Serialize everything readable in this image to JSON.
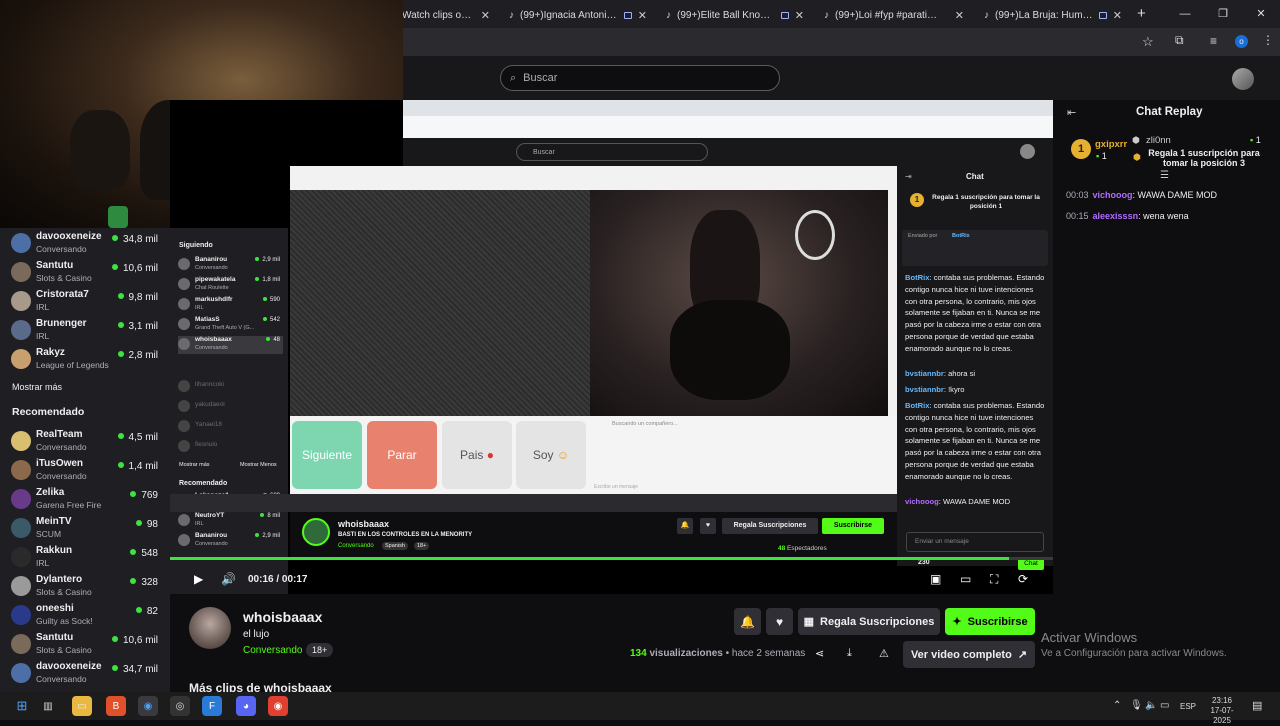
{
  "tabs": [
    {
      "title": "Watch clips on K",
      "icon": ""
    },
    {
      "title": "(99+)Ignacia Antonia y AKA",
      "icon": "tiktok"
    },
    {
      "title": "(99+)Elite Ball Knowlage. #",
      "icon": "tiktok"
    },
    {
      "title": "(99+)Loi #fyp #paratiiiiiiiiiiiii",
      "icon": "tiktok"
    },
    {
      "title": "(99+)La Bruja: Humor Peru",
      "icon": "tiktok"
    }
  ],
  "search": {
    "placeholder": "Buscar"
  },
  "sidebar": {
    "top_channels": [
      {
        "name": "davooxeneize",
        "category": "Conversando",
        "viewers": "34,8 mil",
        "color": "#4d6fa8"
      },
      {
        "name": "Santutu",
        "category": "Slots & Casino",
        "viewers": "10,6 mil",
        "color": "#7a6a5a"
      },
      {
        "name": "Cristorata7",
        "category": "IRL",
        "viewers": "9,8 mil",
        "color": "#a89a8a"
      },
      {
        "name": "Brunenger",
        "category": "IRL",
        "viewers": "3,1 mil",
        "color": "#5a6a8a"
      },
      {
        "name": "Rakyz",
        "category": "League of Legends",
        "viewers": "2,8 mil",
        "color": "#c8a070"
      }
    ],
    "show_more": "Mostrar más",
    "recommended_title": "Recomendado",
    "recommended": [
      {
        "name": "RealTeam",
        "category": "Conversando",
        "viewers": "4,5 mil",
        "color": "#d9c070"
      },
      {
        "name": "iTusOwen",
        "category": "Conversando",
        "viewers": "1,4 mil",
        "color": "#8a6a4a"
      },
      {
        "name": "Zelika",
        "category": "Garena Free Fire",
        "viewers": "769",
        "color": "#6a3a8a"
      },
      {
        "name": "MeinTV",
        "category": "SCUM",
        "viewers": "98",
        "color": "#3a5a6a"
      },
      {
        "name": "Rakkun",
        "category": "IRL",
        "viewers": "548",
        "color": "#2a2a2a"
      },
      {
        "name": "Dylantero",
        "category": "Slots & Casino",
        "viewers": "328",
        "color": "#9a9a9a"
      },
      {
        "name": "oneeshi",
        "category": "Guilty as Sock!",
        "viewers": "82",
        "color": "#2a3a8a"
      },
      {
        "name": "Santutu",
        "category": "Slots & Casino",
        "viewers": "10,6 mil",
        "color": "#7a6a5a"
      },
      {
        "name": "davooxeneize",
        "category": "Conversando",
        "viewers": "34,7 mil",
        "color": "#4d6fa8"
      }
    ]
  },
  "nested": {
    "search_placeholder": "Buscar",
    "following_title": "Siguiendo",
    "following": [
      {
        "name": "Bananirou",
        "category": "Conversando",
        "viewers": "2,9 mil"
      },
      {
        "name": "pipewakatela",
        "category": "Chat Roulette",
        "viewers": "1,8 mil"
      },
      {
        "name": "markushdlfr",
        "category": "IRL",
        "viewers": "590"
      },
      {
        "name": "MatiasS",
        "category": "Grand Theft Auto V (G...",
        "viewers": "542"
      },
      {
        "name": "whoisbaaax",
        "category": "Conversando",
        "viewers": "48"
      }
    ],
    "offline": [
      "lihanncoki",
      "yakudaeol",
      "Yanaei18",
      "fiesnulo"
    ],
    "show_more": "Mostrar más",
    "show_less": "Mostrar Menos",
    "recommended_title": "Recomendado",
    "recommended": [
      {
        "name": "Lokonazo1",
        "category": "Counter-Strike 2",
        "viewers": "609"
      },
      {
        "name": "NeutroYT",
        "category": "IRL",
        "viewers": "8 mil"
      },
      {
        "name": "Bananirou",
        "category": "Conversando",
        "viewers": "2,9 mil"
      }
    ],
    "buttons": [
      "Siguiente",
      "Parar",
      "Pais",
      "Soy"
    ],
    "input_hint": "Escribe un mensaje",
    "notice": "Buscando un compañero...",
    "streamer": "whoisbaaax",
    "stream_title": "BASTI EN LOS CONTROLES EN LA MENORITY",
    "category": "Conversando",
    "tags": [
      "Spanish",
      "18+"
    ],
    "gift_label": "Regala Suscripciones",
    "subscribe_label": "Suscribirse",
    "viewers_count": "48",
    "viewers_label": "Espectadores",
    "chat_title": "Chat",
    "pinned": "Regala 1 suscripción para tomar la posición 1",
    "sent_by": "Enviado por",
    "bot": "BotRix",
    "chat_input": "Enviar un mensaje",
    "chat_button": "Chat",
    "points": "230",
    "messages": [
      {
        "user": "BotRix",
        "text": "contaba sus problemas. Estando contigo nunca hice ni tuve intenciones con otra persona, lo contrario, mis ojos solamente se fijaban en ti. Nunca se me pasó por la cabeza irme o estar con otra persona porque de verdad que estaba enamorado aunque no lo creas."
      },
      {
        "user": "bvstiannbr",
        "text": "ahora si"
      },
      {
        "user": "bvstiannbr",
        "text": "!kyro"
      },
      {
        "user": "BotRix",
        "text": "contaba sus problemas. Estando contigo nunca hice ni tuve intenciones con otra persona, lo contrario, mis ojos solamente se fijaban en ti. Nunca se me pasó por la cabeza irme o estar con otra persona porque de verdad que estaba enamorado aunque no lo creas."
      },
      {
        "user": "vichooog",
        "text": "WAWA DAME MOD"
      }
    ]
  },
  "player": {
    "time_current": "00:16",
    "time_total": "00:17",
    "progress": 0.95
  },
  "chat": {
    "title": "Chat Replay",
    "leader_name": "gxipxrr",
    "leader_rank": "1",
    "leader_count": "1",
    "gift_user": "zli0nn",
    "gift_count": "1",
    "gift_text": "Regala 1 suscripción para tomar la posición 3",
    "messages": [
      {
        "time": "00:03",
        "user": "vichooog",
        "sep": ": ",
        "text": "WAWA DAME MOD",
        "color": "#b06cff"
      },
      {
        "time": "00:15",
        "user": "aleexisssn",
        "sep": ": ",
        "text": "wena wena",
        "color": "#b06cff"
      }
    ]
  },
  "info": {
    "channel": "whoisbaaax",
    "clip_title": "el lujo",
    "category": "Conversando",
    "tag": "18+",
    "views_count": "134",
    "views_label": "visualizaciones",
    "sep": "•",
    "time_ago": "hace 2 semanas",
    "gift_label": "Regala Suscripciones",
    "subscribe_label": "Suscribirse",
    "full_video_label": "Ver video completo",
    "more_clips": "Más clips de whoisbaaax"
  },
  "watermark": {
    "title": "Activar Windows",
    "subtitle": "Ve a Configuración para activar Windows."
  },
  "taskbar": {
    "lang": "ESP",
    "time": "23:16",
    "date": "17-07-2025"
  },
  "colors": {
    "accent": "#53fc18",
    "bg": "#0e0e10",
    "sidebar": "#1f1f23"
  }
}
